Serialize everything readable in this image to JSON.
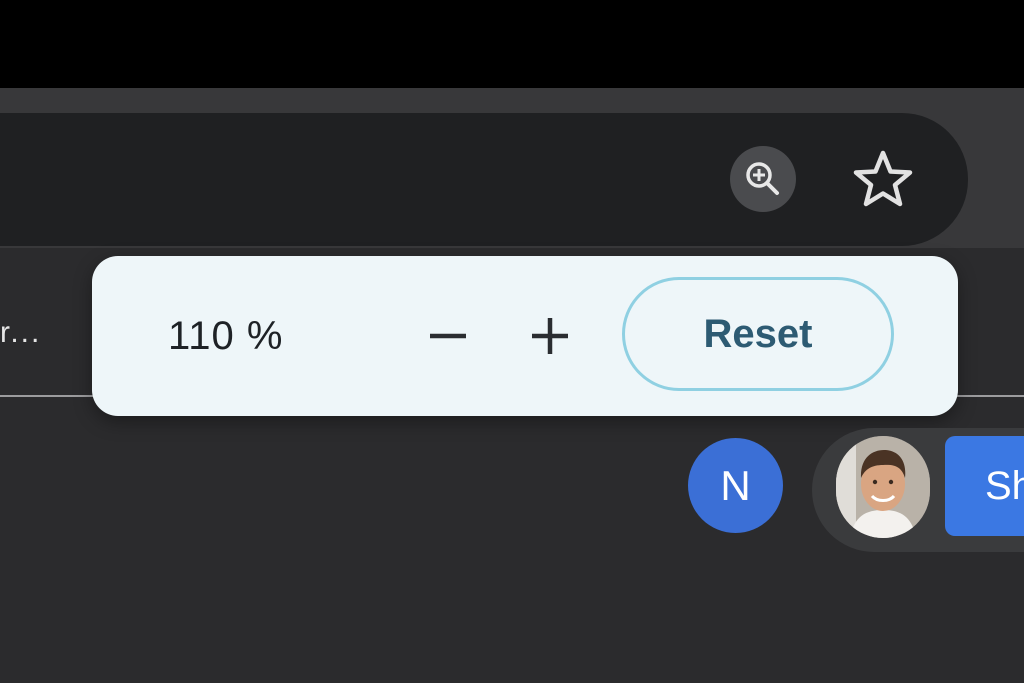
{
  "toolbar": {
    "zoom_icon": "zoom-in-magnifier-icon",
    "bookmark_icon": "star-outline-icon"
  },
  "tab": {
    "truncated_title": "r..."
  },
  "zoom_popup": {
    "level": "110 %",
    "decrease_symbol": "−",
    "increase_symbol": "+",
    "reset_label": "Reset"
  },
  "account": {
    "initial": "N",
    "share_label": "Sh"
  },
  "colors": {
    "accent": "#3b78e3",
    "avatar_bg": "#3b6fd6",
    "reset_border": "#8fd0e2",
    "reset_text": "#2d5b73",
    "popup_bg": "#eef6f9"
  }
}
